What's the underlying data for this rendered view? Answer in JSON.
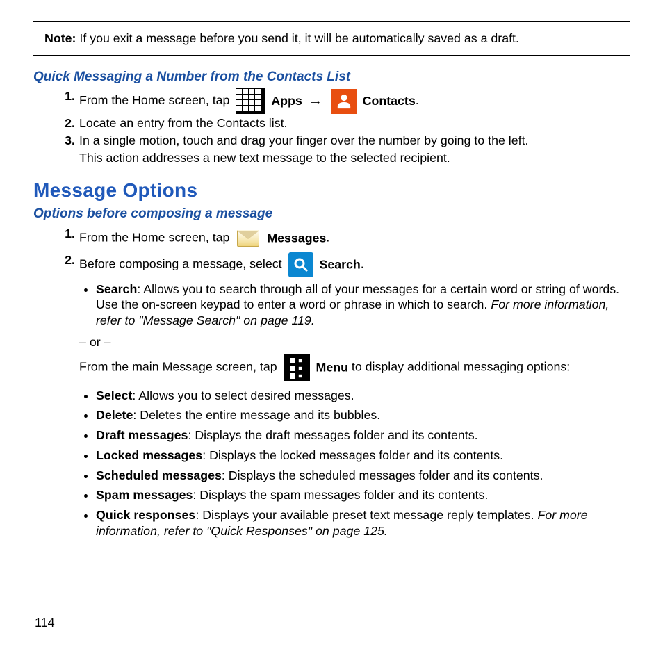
{
  "note": {
    "label": "Note:",
    "text": " If you exit a message before you send it, it will be automatically saved as a draft."
  },
  "section1": {
    "heading": "Quick Messaging a Number from the Contacts List",
    "step1_pre": "From the Home screen, tap ",
    "step1_apps": " Apps ",
    "step1_arrow": "→",
    "step1_contacts": " Contacts",
    "step1_period": ".",
    "step2": "Locate an entry from the Contacts list.",
    "step3a": "In a single motion, touch and drag your finger over the number by going to the left.",
    "step3b": "This action addresses a new text message to the selected recipient."
  },
  "heading2": "Message Options",
  "section2": {
    "heading": "Options before composing a message",
    "step1_pre": "From the Home screen, tap ",
    "step1_messages": " Messages",
    "step1_period": ".",
    "step2_pre": "Before composing a message, select ",
    "step2_search": " Search",
    "step2_period": ".",
    "search_bullet_label": "Search",
    "search_bullet_text": ": Allows you to search through all of your messages for a certain word or string of words. Use the on-screen keypad to enter a word or phrase in which to search. ",
    "search_bullet_ref": "For more information, refer to \"Message Search\" on page 119.",
    "or_text": "– or –",
    "menu_pre": "From the main Message screen, tap ",
    "menu_label": " Menu",
    "menu_post": " to display additional messaging options:",
    "menu_items": [
      {
        "label": "Select",
        "text": ": Allows you to select desired messages."
      },
      {
        "label": "Delete",
        "text": ": Deletes the entire message and its bubbles."
      },
      {
        "label": "Draft messages",
        "text": ": Displays the draft messages folder and its contents."
      },
      {
        "label": "Locked messages",
        "text": ": Displays the locked messages folder and its contents."
      },
      {
        "label": "Scheduled messages",
        "text": ": Displays the scheduled messages folder and its contents."
      },
      {
        "label": "Spam messages",
        "text": ": Displays the spam messages folder and its contents."
      },
      {
        "label": "Quick responses",
        "text": ": Displays your available preset text message reply templates. ",
        "ref": "For more information, refer to \"Quick Responses\" on page 125."
      }
    ]
  },
  "page_number": "114"
}
